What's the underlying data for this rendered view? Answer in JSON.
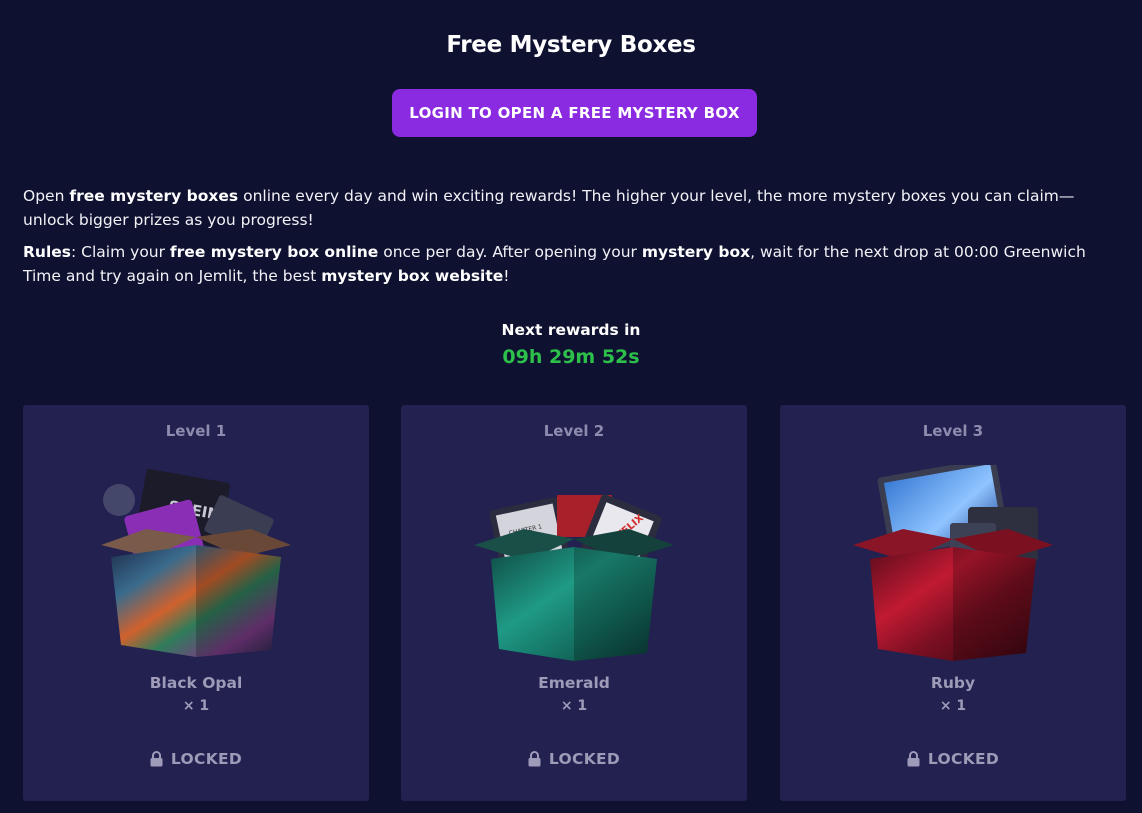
{
  "header": {
    "title": "Free Mystery Boxes",
    "login_label": "LOGIN TO OPEN A FREE MYSTERY BOX"
  },
  "description": {
    "p1": [
      {
        "t": "Open ",
        "b": false
      },
      {
        "t": "free mystery boxes",
        "b": true
      },
      {
        "t": " online every day and win exciting rewards! The higher your level, the more mystery boxes you can claim—unlock bigger prizes as you progress!",
        "b": false
      }
    ],
    "p2": [
      {
        "t": "Rules",
        "b": true
      },
      {
        "t": ": Claim your ",
        "b": false
      },
      {
        "t": "free mystery box online",
        "b": true
      },
      {
        "t": " once per day. After opening your ",
        "b": false
      },
      {
        "t": "mystery box",
        "b": true
      },
      {
        "t": ", wait for the next drop at 00:00 Greenwich Time and try again on Jemlit, the best ",
        "b": false
      },
      {
        "t": "mystery box website",
        "b": true
      },
      {
        "t": "!",
        "b": false
      }
    ]
  },
  "countdown": {
    "label": "Next rewards in",
    "value": "09h 29m 52s",
    "color": "#2cbf4a"
  },
  "boxes": [
    {
      "level": "Level 1",
      "name": "Black Opal",
      "qty": "× 1",
      "status": "LOCKED",
      "icon": "lock-icon",
      "art": "black-opal-box-image",
      "art_labels": [
        "SHEIN"
      ]
    },
    {
      "level": "Level 2",
      "name": "Emerald",
      "qty": "× 1",
      "status": "LOCKED",
      "icon": "lock-icon",
      "art": "emerald-box-image",
      "art_labels": [
        "CHAPTER 1",
        "NETFLIX"
      ]
    },
    {
      "level": "Level 3",
      "name": "Ruby",
      "qty": "× 1",
      "status": "LOCKED",
      "icon": "lock-icon",
      "art": "ruby-box-image",
      "art_labels": []
    }
  ],
  "colors": {
    "background": "#0f1130",
    "card": "#222150",
    "accent": "#8a2be2",
    "muted_text": "#9d9bb8"
  }
}
